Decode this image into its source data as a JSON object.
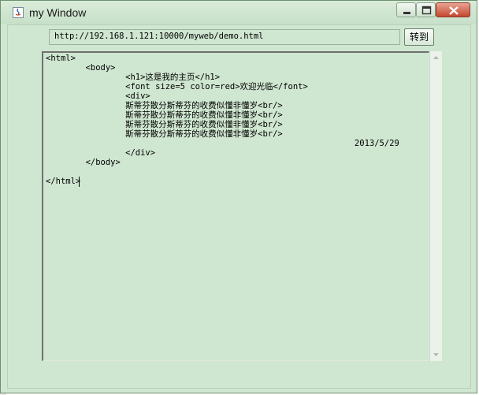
{
  "window": {
    "title": "my Window",
    "controls": {
      "minimize": "minimize",
      "maximize": "maximize",
      "close": "close"
    }
  },
  "toolbar": {
    "url_value": "http://192.168.1.121:10000/myweb/demo.html",
    "go_label": "转到"
  },
  "content": {
    "lines": [
      "<html>",
      "        <body>",
      "                <h1>这是我的主页</h1>",
      "                <font size=5 color=red>欢迎光临</font>",
      "                <div>",
      "                斯蒂芬散分斯蒂芬的收费似懂非懂岁<br/>",
      "                斯蒂芬散分斯蒂芬的收费似懂非懂岁<br/>",
      "                斯蒂芬散分斯蒂芬的收费似懂非懂岁<br/>",
      "                斯蒂芬散分斯蒂芬的收费似懂非懂岁<br/>",
      "                                                              2013/5/29",
      "                </div>",
      "        </body>",
      "",
      "</html>"
    ]
  },
  "colors": {
    "background": "#cfe6d0",
    "close_button": "#c5472f"
  }
}
